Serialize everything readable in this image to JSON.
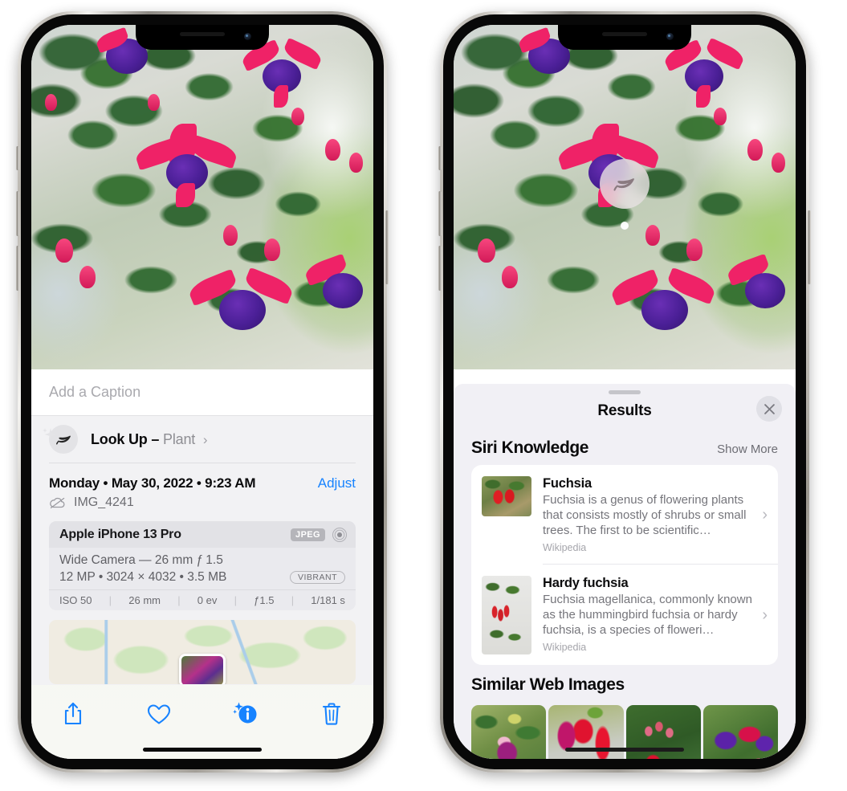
{
  "left_phone": {
    "caption_placeholder": "Add a Caption",
    "lookup": {
      "label": "Look Up",
      "dash": "–",
      "subject": "Plant",
      "chevron": "›",
      "icon": "leaf-icon"
    },
    "date": "Monday • May 30, 2022 • 9:23 AM",
    "adjust_label": "Adjust",
    "filename": "IMG_4241",
    "camera": {
      "model": "Apple iPhone 13 Pro",
      "format_badge": "JPEG",
      "lens_icon": "aperture-icon",
      "lens_line": "Wide Camera — 26 mm ƒ 1.5",
      "specs_line": "12 MP • 3024 × 4032 • 3.5 MB",
      "style_badge": "VIBRANT",
      "exif": [
        "ISO 50",
        "26 mm",
        "0 ev",
        "ƒ1.5",
        "1/181 s"
      ]
    },
    "toolbar": [
      {
        "name": "share-button",
        "icon": "share-icon"
      },
      {
        "name": "favorite-button",
        "icon": "heart-icon"
      },
      {
        "name": "info-button",
        "icon": "info-sparkle-icon"
      },
      {
        "name": "delete-button",
        "icon": "trash-icon"
      }
    ],
    "accent_color": "#1783ff"
  },
  "right_phone": {
    "badge_icon": "leaf-icon",
    "sheet": {
      "title": "Results",
      "close_label": "✕",
      "sections": [
        {
          "title": "Siri Knowledge",
          "action": "Show More",
          "items": [
            {
              "title": "Fuchsia",
              "description": "Fuchsia is a genus of flowering plants that consists mostly of shrubs or small trees. The first to be scientific…",
              "source": "Wikipedia",
              "chevron": "›"
            },
            {
              "title": "Hardy fuchsia",
              "description": "Fuchsia magellanica, commonly known as the hummingbird fuchsia or hardy fuchsia, is a species of floweri…",
              "source": "Wikipedia",
              "chevron": "›"
            }
          ]
        },
        {
          "title": "Similar Web Images",
          "thumbs": [
            "web-image-1",
            "web-image-2",
            "web-image-3",
            "web-image-4"
          ]
        }
      ]
    }
  }
}
